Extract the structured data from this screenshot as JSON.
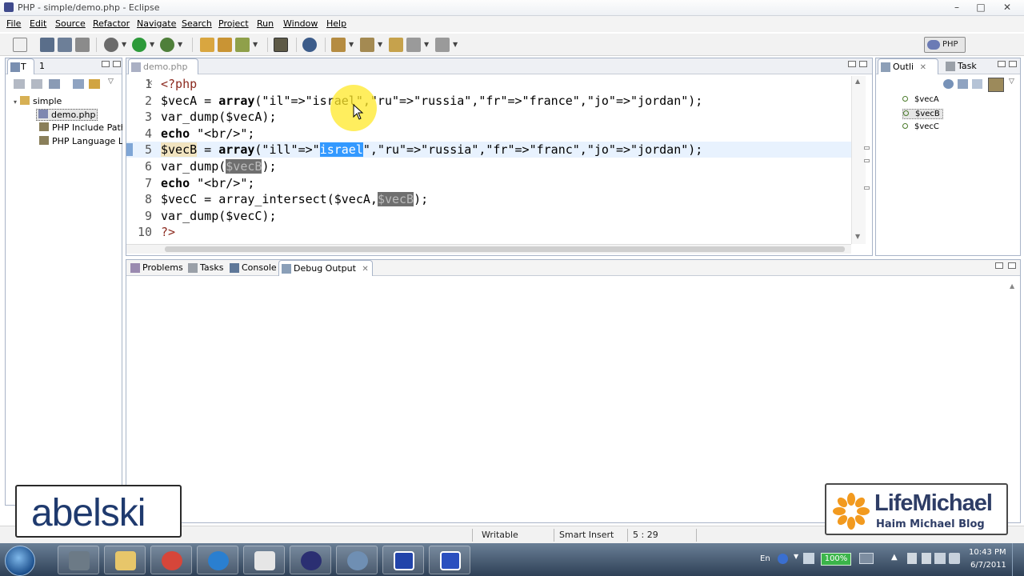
{
  "window": {
    "title": "PHP - simple/demo.php - Eclipse",
    "controls": [
      "–",
      "□",
      "✕"
    ]
  },
  "menubar": [
    "File",
    "Edit",
    "Source",
    "Refactor",
    "Navigate",
    "Search",
    "Project",
    "Run",
    "Window",
    "Help"
  ],
  "toolbar": {
    "perspective_label": "PHP"
  },
  "explorer": {
    "tab_labels": [
      "T",
      "1"
    ],
    "tree": [
      {
        "label": "simple",
        "icon": "project-icon",
        "level": 0
      },
      {
        "label": "demo.php",
        "icon": "php-file-icon",
        "level": 1,
        "selected": true
      },
      {
        "label": "PHP Include Path",
        "icon": "library-icon",
        "level": 1
      },
      {
        "label": "PHP Language Li",
        "icon": "library-icon",
        "level": 1
      }
    ]
  },
  "editor": {
    "tab_label": "demo.php",
    "line_numbers": [
      "1",
      "2",
      "3",
      "4",
      "5",
      "6",
      "7",
      "8",
      "9",
      "10"
    ],
    "lines": [
      [
        {
          "t": "<?php",
          "c": "tag"
        }
      ],
      [
        {
          "t": "$vecA = "
        },
        {
          "t": "array",
          "c": "kw"
        },
        {
          "t": "(\"il\"=>\""
        },
        {
          "t": "israel"
        },
        {
          "t": "\",\"ru\"=>\"russia\",\"fr\"=>\"france\",\"jo\"=>\"jordan\");"
        }
      ],
      [
        {
          "t": "var_dump($vecA);"
        }
      ],
      [
        {
          "t": "echo",
          "c": "kw"
        },
        {
          "t": " \"<br/>\";"
        }
      ],
      [
        {
          "t": "$vecB",
          "c": "warn-mark"
        },
        {
          "t": " = "
        },
        {
          "t": "array",
          "c": "kw"
        },
        {
          "t": "(\"ill\"=>\""
        },
        {
          "t": "israel",
          "c": "sel"
        },
        {
          "t": "\",\"ru\"=>\"russia\",\"fr\"=>\"franc\",\"jo\"=>\"jordan\");"
        }
      ],
      [
        {
          "t": "var_dump("
        },
        {
          "t": "$vecB",
          "c": "dark-occ"
        },
        {
          "t": ");"
        }
      ],
      [
        {
          "t": "echo",
          "c": "kw"
        },
        {
          "t": " \"<br/>\";"
        }
      ],
      [
        {
          "t": "$vecC = array_intersect($vecA,"
        },
        {
          "t": "$vecB",
          "c": "dark-occ"
        },
        {
          "t": ");"
        }
      ],
      [
        {
          "t": "var_dump($vecC);"
        }
      ],
      [
        {
          "t": "?>",
          "c": "tag"
        }
      ]
    ]
  },
  "outline": {
    "tab_labels": [
      "Outli",
      "Task"
    ],
    "items": [
      "$vecA",
      "$vecB",
      "$vecC"
    ]
  },
  "bottom_panel": {
    "tabs": [
      "Problems",
      "Tasks",
      "Console",
      "Debug Output"
    ]
  },
  "statusbar": {
    "mode": "Writable",
    "insert": "Smart Insert",
    "position": "5 : 29"
  },
  "watermarks": {
    "left": "abelski",
    "right_title": "LifeMichael",
    "right_subtitle": "Haim Michael Blog"
  },
  "taskbar": {
    "lang": "En",
    "battery": "100%",
    "time": "10:43 PM",
    "date": "6/7/2011"
  },
  "colors": {
    "keyword": "#000000",
    "tag": "#8c2a1f",
    "selection": "#3399ff",
    "current_line": "#e8f2fe",
    "cursor_highlight": "#ffe828"
  }
}
